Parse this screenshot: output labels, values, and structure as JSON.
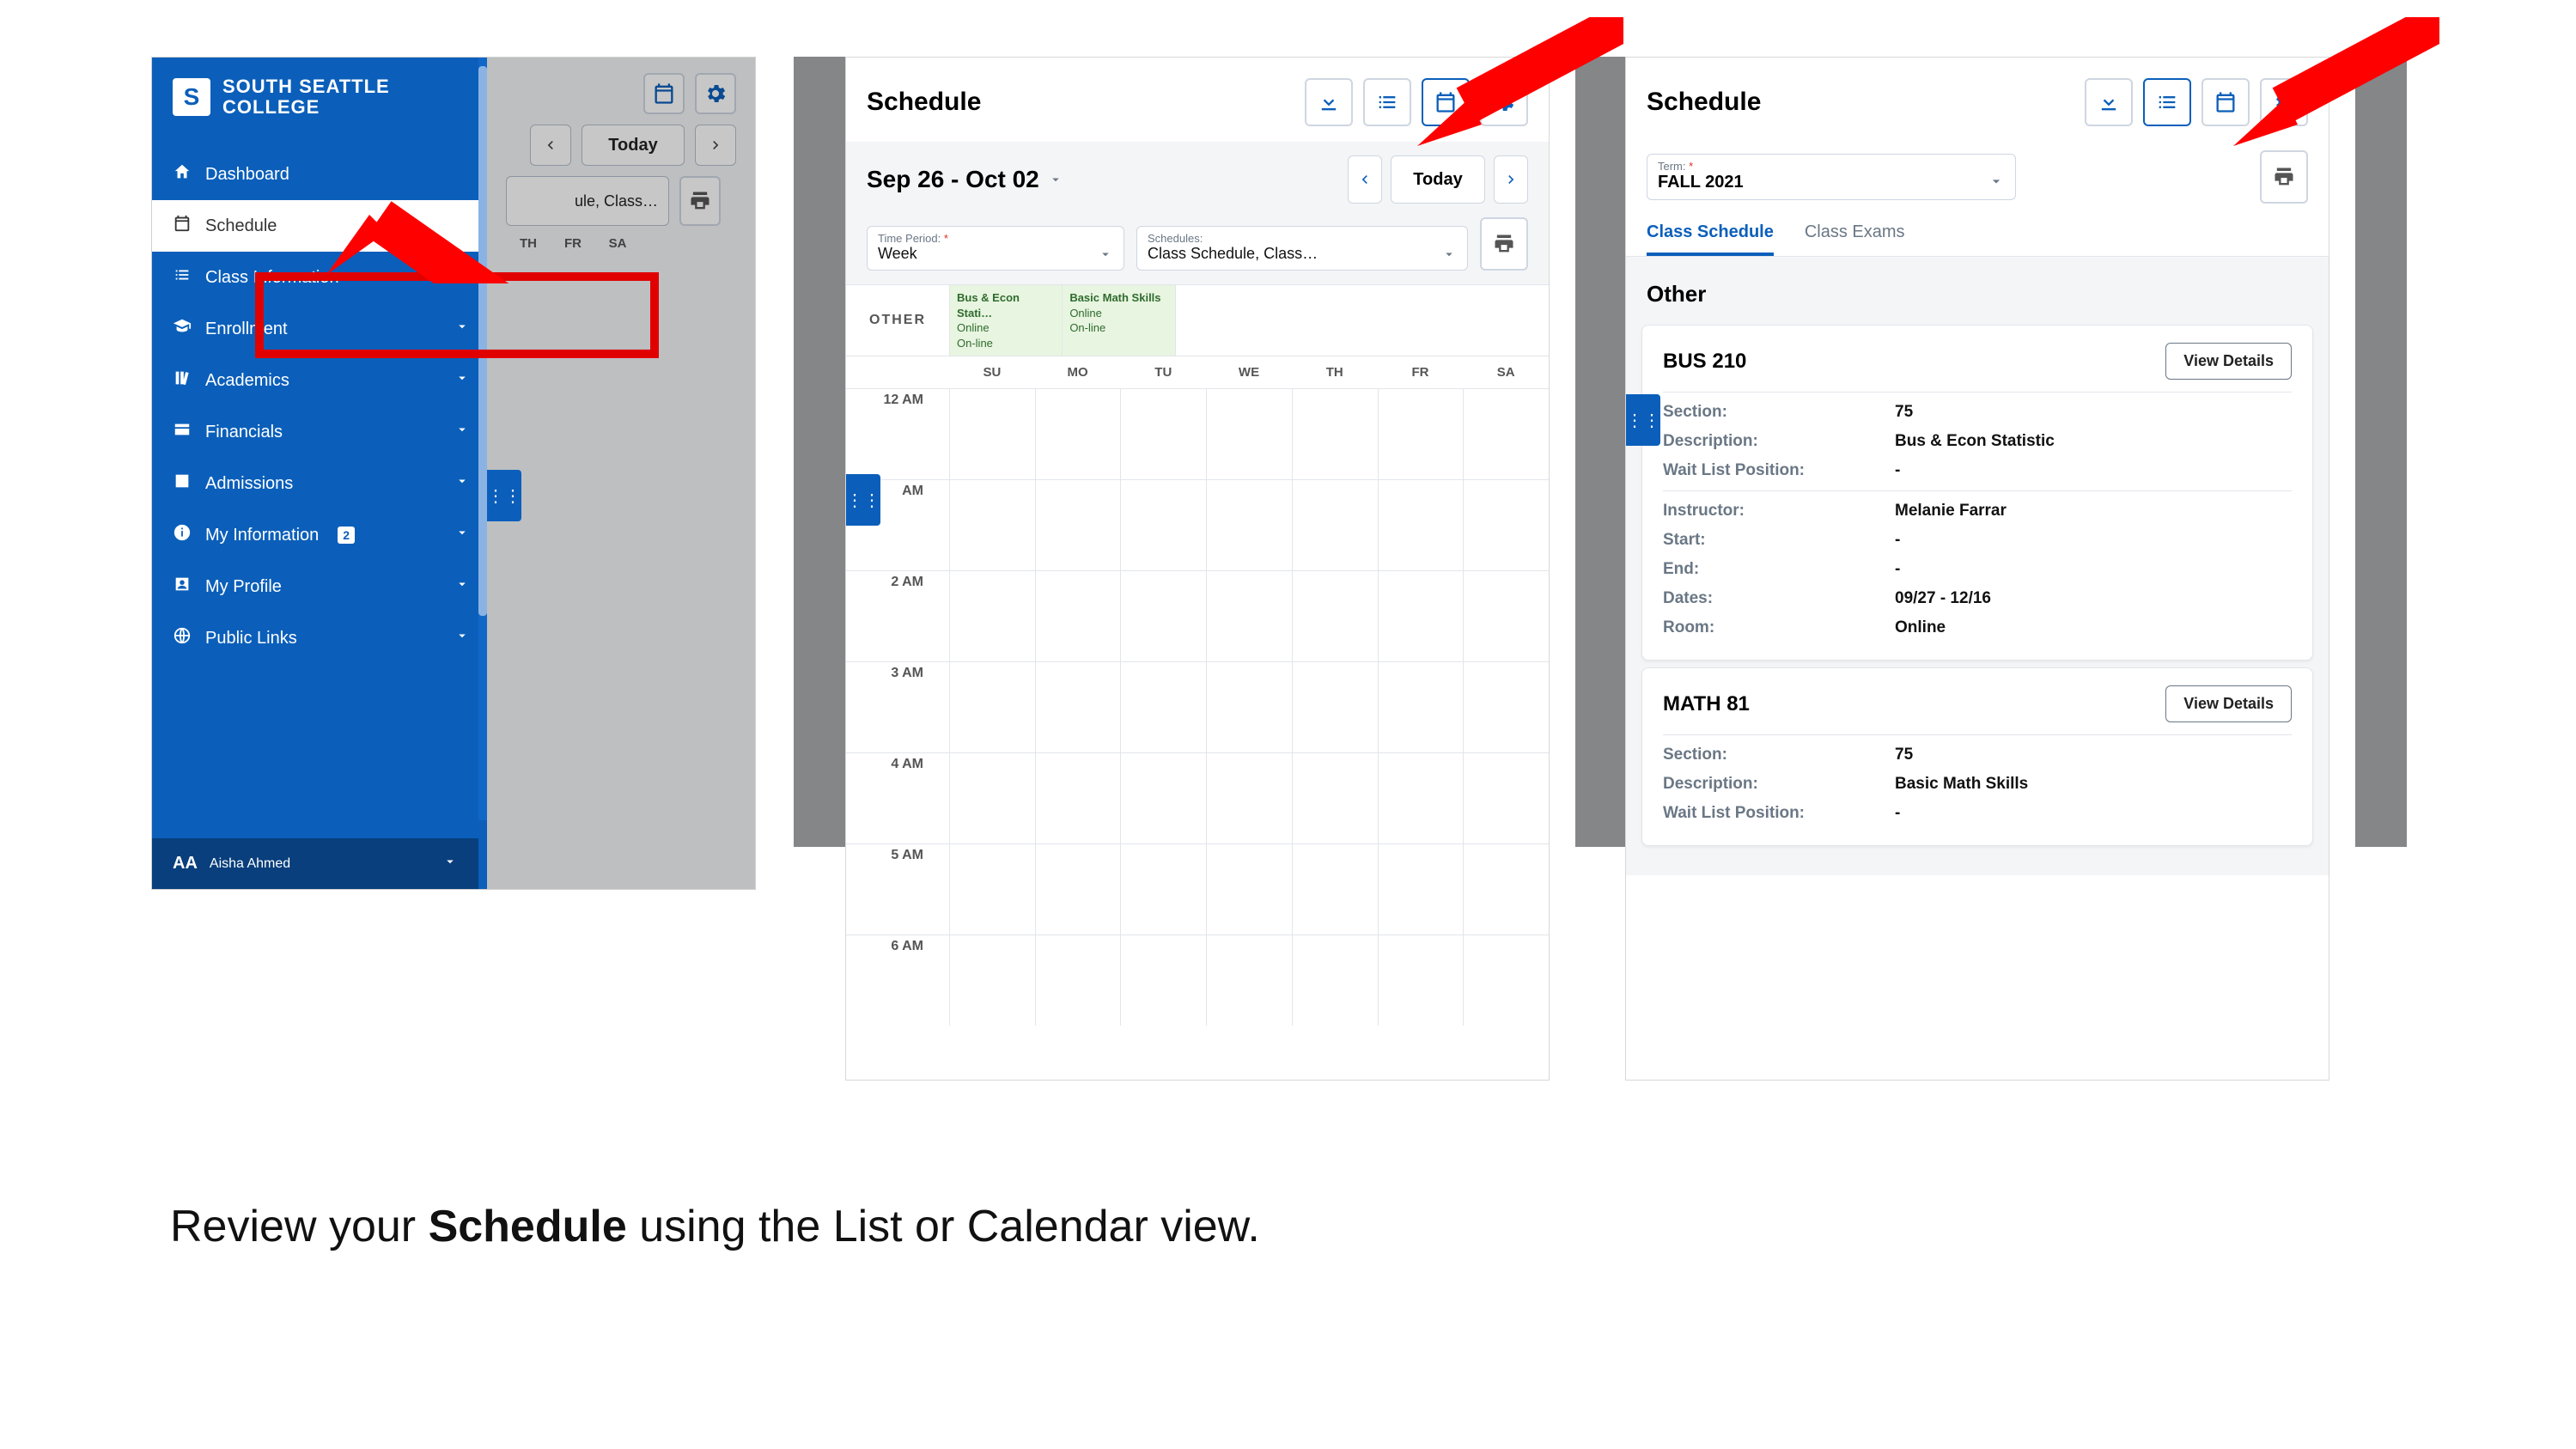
{
  "college": {
    "line1": "SOUTH SEATTLE",
    "line2": "COLLEGE",
    "logo_letter": "S"
  },
  "sidebar": {
    "items": [
      {
        "label": "Dashboard",
        "icon": "home-icon"
      },
      {
        "label": "Schedule",
        "icon": "calendar-icon"
      },
      {
        "label": "Class Information",
        "icon": "list-icon"
      },
      {
        "label": "Enrollment",
        "icon": "grad-cap-icon"
      },
      {
        "label": "Academics",
        "icon": "library-icon"
      },
      {
        "label": "Financials",
        "icon": "card-icon"
      },
      {
        "label": "Admissions",
        "icon": "square-icon"
      },
      {
        "label": "My Information",
        "icon": "info-icon",
        "badge": "2"
      },
      {
        "label": "My Profile",
        "icon": "person-icon"
      },
      {
        "label": "Public Links",
        "icon": "globe-icon"
      }
    ],
    "user": {
      "initials": "AA",
      "name": "Aisha Ahmed"
    }
  },
  "shot1": {
    "today": "Today",
    "filter_text": "ule, Class…",
    "day_headers": [
      "TH",
      "FR",
      "SA"
    ]
  },
  "shot2": {
    "title": "Schedule",
    "date_range": "Sep 26 - Oct 02",
    "today": "Today",
    "time_period": {
      "label": "Time Period:",
      "value": "Week"
    },
    "schedules": {
      "label": "Schedules:",
      "value": "Class Schedule, Class…"
    },
    "other_label": "OTHER",
    "other_cells": [
      {
        "title": "Bus & Econ Stati…",
        "l2": "Online",
        "l3": "On-line"
      },
      {
        "title": "Basic Math Skills",
        "l2": "Online",
        "l3": "On-line"
      }
    ],
    "days": [
      "SU",
      "MO",
      "TU",
      "WE",
      "TH",
      "FR",
      "SA"
    ],
    "hours": [
      "12 AM",
      "AM",
      "2 AM",
      "3 AM",
      "4 AM",
      "5 AM",
      "6 AM"
    ]
  },
  "shot3": {
    "title": "Schedule",
    "term_label": "Term:",
    "term_value": "FALL 2021",
    "tabs": [
      "Class Schedule",
      "Class Exams"
    ],
    "section": "Other",
    "view_details": "View Details",
    "courses": [
      {
        "code": "BUS 210",
        "rows1": [
          {
            "k": "Section:",
            "v": "75"
          },
          {
            "k": "Description:",
            "v": "Bus & Econ Statistic"
          },
          {
            "k": "Wait List Position:",
            "v": "-"
          }
        ],
        "rows2": [
          {
            "k": "Instructor:",
            "v": "Melanie Farrar"
          },
          {
            "k": "Start:",
            "v": "-"
          },
          {
            "k": "End:",
            "v": "-"
          },
          {
            "k": "Dates:",
            "v": "09/27 - 12/16"
          },
          {
            "k": "Room:",
            "v": "Online"
          }
        ]
      },
      {
        "code": "MATH 81",
        "rows1": [
          {
            "k": "Section:",
            "v": "75"
          },
          {
            "k": "Description:",
            "v": "Basic Math Skills"
          },
          {
            "k": "Wait List Position:",
            "v": "-"
          }
        ],
        "rows2": []
      }
    ]
  },
  "caption": {
    "pre": "Review your ",
    "bold": "Schedule",
    "post": " using the List or Calendar view."
  }
}
